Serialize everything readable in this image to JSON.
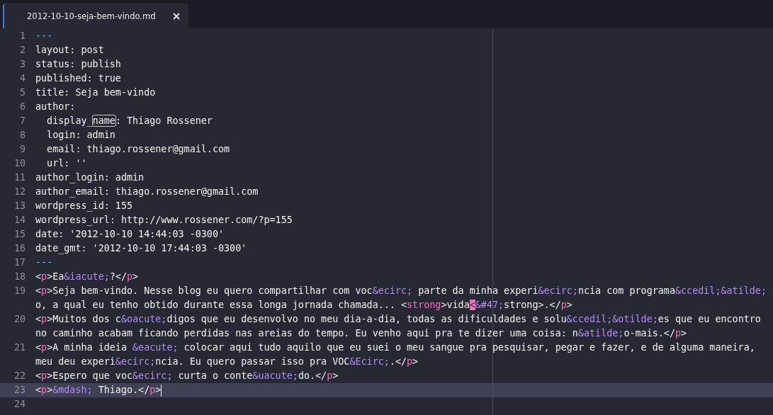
{
  "tabs": [
    {
      "label": "2012-10-10-seja-bem-vindo.md",
      "selected": true
    }
  ],
  "editor": {
    "lines": [
      {
        "number": "1",
        "wraps": [
          {
            "segments": [
              {
                "kind": "rule",
                "text": "---"
              }
            ]
          }
        ]
      },
      {
        "number": "2",
        "wraps": [
          {
            "segments": [
              {
                "kind": "text",
                "text": "layout: post"
              }
            ]
          }
        ]
      },
      {
        "number": "3",
        "wraps": [
          {
            "segments": [
              {
                "kind": "text",
                "text": "status: publish"
              }
            ]
          }
        ]
      },
      {
        "number": "4",
        "wraps": [
          {
            "segments": [
              {
                "kind": "text",
                "text": "published: true"
              }
            ]
          }
        ]
      },
      {
        "number": "5",
        "wraps": [
          {
            "segments": [
              {
                "kind": "text",
                "text": "title: Seja bem-vindo"
              }
            ]
          }
        ]
      },
      {
        "number": "6",
        "wraps": [
          {
            "segments": [
              {
                "kind": "text",
                "text": "author:"
              }
            ]
          }
        ]
      },
      {
        "number": "7",
        "wraps": [
          {
            "segments": [
              {
                "kind": "text",
                "text": "  display_"
              },
              {
                "kind": "match",
                "text": "name"
              },
              {
                "kind": "text",
                "text": ": Thiago Rossener"
              }
            ]
          }
        ]
      },
      {
        "number": "8",
        "wraps": [
          {
            "segments": [
              {
                "kind": "text",
                "text": "  login: admin"
              }
            ]
          }
        ]
      },
      {
        "number": "9",
        "wraps": [
          {
            "segments": [
              {
                "kind": "text",
                "text": "  email: thiago.rossener@gmail.com"
              }
            ]
          }
        ]
      },
      {
        "number": "10",
        "wraps": [
          {
            "segments": [
              {
                "kind": "text",
                "text": "  url: ''"
              }
            ]
          }
        ]
      },
      {
        "number": "11",
        "wraps": [
          {
            "segments": [
              {
                "kind": "text",
                "text": "author_login: admin"
              }
            ]
          }
        ]
      },
      {
        "number": "12",
        "wraps": [
          {
            "segments": [
              {
                "kind": "text",
                "text": "author_email: thiago.rossener@gmail.com"
              }
            ]
          }
        ]
      },
      {
        "number": "13",
        "wraps": [
          {
            "segments": [
              {
                "kind": "text",
                "text": "wordpress_id: 155"
              }
            ]
          }
        ]
      },
      {
        "number": "14",
        "wraps": [
          {
            "segments": [
              {
                "kind": "text",
                "text": "wordpress_url: http://www.rossener.com/?p=155"
              }
            ]
          }
        ]
      },
      {
        "number": "15",
        "wraps": [
          {
            "segments": [
              {
                "kind": "text",
                "text": "date: '2012-10-10 14:44:03 -0300'"
              }
            ]
          }
        ]
      },
      {
        "number": "16",
        "wraps": [
          {
            "segments": [
              {
                "kind": "text",
                "text": "date_gmt: '2012-10-10 17:44:03 -0300'"
              }
            ]
          }
        ]
      },
      {
        "number": "17",
        "wraps": [
          {
            "segments": [
              {
                "kind": "rule",
                "text": "---"
              }
            ]
          }
        ]
      },
      {
        "number": "18",
        "wraps": [
          {
            "segments": [
              {
                "kind": "text",
                "text": "<"
              },
              {
                "kind": "tag",
                "text": "p"
              },
              {
                "kind": "text",
                "text": ">Ea"
              },
              {
                "kind": "entity",
                "text": "&iacute;"
              },
              {
                "kind": "text",
                "text": "?</"
              },
              {
                "kind": "tag",
                "text": "p"
              },
              {
                "kind": "text",
                "text": ">"
              }
            ]
          }
        ]
      },
      {
        "number": "19",
        "wraps": [
          {
            "segments": [
              {
                "kind": "text",
                "text": "<"
              },
              {
                "kind": "tag",
                "text": "p"
              },
              {
                "kind": "text",
                "text": ">Seja bem-vindo. Nesse blog eu quero compartilhar com voc"
              },
              {
                "kind": "entity",
                "text": "&ecirc;"
              },
              {
                "kind": "text",
                "text": " parte da minha experi"
              },
              {
                "kind": "entity",
                "text": "&ecirc;"
              },
              {
                "kind": "text",
                "text": "ncia com programa"
              },
              {
                "kind": "entity",
                "text": "&ccedil;&atilde;"
              }
            ]
          },
          {
            "segments": [
              {
                "kind": "text",
                "text": "o, a qual eu tenho obtido durante essa longa jornada chamada... <"
              },
              {
                "kind": "tag",
                "text": "strong"
              },
              {
                "kind": "text",
                "text": ">vida"
              },
              {
                "kind": "invalid",
                "text": "<"
              },
              {
                "kind": "entity",
                "text": "&#47;"
              },
              {
                "kind": "text",
                "text": "strong>.</"
              },
              {
                "kind": "tag",
                "text": "p"
              },
              {
                "kind": "text",
                "text": ">"
              }
            ]
          }
        ]
      },
      {
        "number": "20",
        "wraps": [
          {
            "segments": [
              {
                "kind": "text",
                "text": "<"
              },
              {
                "kind": "tag",
                "text": "p"
              },
              {
                "kind": "text",
                "text": ">Muitos dos c"
              },
              {
                "kind": "entity",
                "text": "&oacute;"
              },
              {
                "kind": "text",
                "text": "digos que eu desenvolvo no meu dia-a-dia, todas as dificuldades e solu"
              },
              {
                "kind": "entity",
                "text": "&ccedil;&otilde;"
              },
              {
                "kind": "text",
                "text": "es que eu encontro"
              }
            ]
          },
          {
            "segments": [
              {
                "kind": "text",
                "text": "no caminho acabam ficando perdidas nas areias do tempo. Eu venho aqui pra te dizer uma coisa: n"
              },
              {
                "kind": "entity",
                "text": "&atilde;"
              },
              {
                "kind": "text",
                "text": "o-mais.</"
              },
              {
                "kind": "tag",
                "text": "p"
              },
              {
                "kind": "text",
                "text": ">"
              }
            ]
          }
        ]
      },
      {
        "number": "21",
        "wraps": [
          {
            "segments": [
              {
                "kind": "text",
                "text": "<"
              },
              {
                "kind": "tag",
                "text": "p"
              },
              {
                "kind": "text",
                "text": ">A minha ideia "
              },
              {
                "kind": "entity",
                "text": "&eacute;"
              },
              {
                "kind": "text",
                "text": " colocar aqui tudo aquilo que eu suei o meu sangue pra pesquisar, pegar e fazer, e de alguma maneira,"
              }
            ]
          },
          {
            "segments": [
              {
                "kind": "text",
                "text": "meu deu experi"
              },
              {
                "kind": "entity",
                "text": "&ecirc;"
              },
              {
                "kind": "text",
                "text": "ncia. Eu quero passar isso pra VOC"
              },
              {
                "kind": "entity",
                "text": "&Ecirc;"
              },
              {
                "kind": "text",
                "text": ".</"
              },
              {
                "kind": "tag",
                "text": "p"
              },
              {
                "kind": "text",
                "text": ">"
              }
            ]
          }
        ]
      },
      {
        "number": "22",
        "wraps": [
          {
            "segments": [
              {
                "kind": "text",
                "text": "<"
              },
              {
                "kind": "tag",
                "text": "p"
              },
              {
                "kind": "text",
                "text": ">Espero que voc"
              },
              {
                "kind": "entity",
                "text": "&ecirc;"
              },
              {
                "kind": "text",
                "text": " curta o conte"
              },
              {
                "kind": "entity",
                "text": "&uacute;"
              },
              {
                "kind": "text",
                "text": "do.</"
              },
              {
                "kind": "tag",
                "text": "p"
              },
              {
                "kind": "text",
                "text": ">"
              }
            ]
          }
        ]
      },
      {
        "number": "23",
        "current": true,
        "wraps": [
          {
            "segments": [
              {
                "kind": "text",
                "text": "<"
              },
              {
                "kind": "tag",
                "text": "p"
              },
              {
                "kind": "text",
                "text": ">"
              },
              {
                "kind": "entity",
                "text": "&mdash;"
              },
              {
                "kind": "text",
                "text": " Thiago.</"
              },
              {
                "kind": "tag",
                "text": "p"
              },
              {
                "kind": "text",
                "text": ">"
              }
            ]
          }
        ]
      },
      {
        "number": "24"
      }
    ]
  }
}
